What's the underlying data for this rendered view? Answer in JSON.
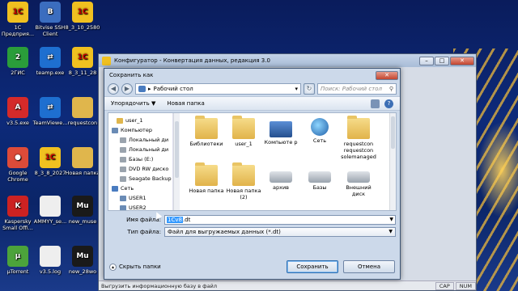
{
  "desktop": {
    "icons": [
      {
        "label": "1С Предприя...",
        "color": "#f0c020",
        "glyph": "1С"
      },
      {
        "label": "Bitvise SSH Client",
        "color": "#3b6dbf",
        "glyph": "B"
      },
      {
        "label": "8_3_10_2580",
        "color": "#f0c020",
        "glyph": "1С"
      },
      {
        "label": "2ГИС",
        "color": "#2a9d3a",
        "glyph": "2"
      },
      {
        "label": "teamp.exe",
        "color": "#1e6fd0",
        "glyph": "⇄"
      },
      {
        "label": "8_3_11_28",
        "color": "#f0c020",
        "glyph": "1С"
      },
      {
        "label": "v3.5.exe",
        "color": "#d42a2a",
        "glyph": "A"
      },
      {
        "label": "TeamViewe...",
        "color": "#1e6fd0",
        "glyph": "⇄"
      },
      {
        "label": "requestcon",
        "color": "#e0b64c",
        "glyph": ""
      },
      {
        "label": "Google Chrome",
        "color": "#dd4b39",
        "glyph": "●"
      },
      {
        "label": "8_3_8_2027",
        "color": "#f0c020",
        "glyph": "1С"
      },
      {
        "label": "Новая папка",
        "color": "#e0b64c",
        "glyph": ""
      },
      {
        "label": "Kaspersky Small Offi...",
        "color": "#c22",
        "glyph": "K"
      },
      {
        "label": "AMMYY_se...",
        "color": "#eee",
        "glyph": ""
      },
      {
        "label": "new_muse",
        "color": "#1a1a1a",
        "glyph": "Mu"
      },
      {
        "label": "µTorrent",
        "color": "#4ca33b",
        "glyph": "µ"
      },
      {
        "label": "v3.5.log",
        "color": "#eee",
        "glyph": ""
      },
      {
        "label": "new_28wo",
        "color": "#1a1a1a",
        "glyph": "Mu"
      }
    ]
  },
  "configurator": {
    "title": "Конфигуратор - Конвертация данных, редакция 3.0",
    "status_text": "Выгрузить информационную базу в файл",
    "status_caps": [
      "CAP",
      "NUM"
    ]
  },
  "dialog": {
    "title": "Сохранить как",
    "address": "Рабочий стол",
    "search_placeholder": "Поиск: Рабочий стол",
    "organize": "Упорядочить ▼",
    "new_folder": "Новая папка",
    "tree": [
      {
        "label": "user_1",
        "color": "#e0b64c",
        "indent": 10
      },
      {
        "label": "Компьютер",
        "color": "#6a8bb5",
        "indent": 4
      },
      {
        "label": "Локальный ди",
        "color": "#9aa3ad",
        "indent": 14
      },
      {
        "label": "Локальный ди",
        "color": "#9aa3ad",
        "indent": 14
      },
      {
        "label": "Базы (E:)",
        "color": "#9aa3ad",
        "indent": 14
      },
      {
        "label": "DVD RW диско",
        "color": "#9aa3ad",
        "indent": 14
      },
      {
        "label": "Seagate Backup",
        "color": "#9aa3ad",
        "indent": 14
      },
      {
        "label": "Сеть",
        "color": "#4a7cc0",
        "indent": 4
      },
      {
        "label": "USER1",
        "color": "#6a8bb5",
        "indent": 14
      },
      {
        "label": "USER2",
        "color": "#6a8bb5",
        "indent": 14
      }
    ],
    "files": [
      {
        "label": "Библиотеки",
        "kind": "folder"
      },
      {
        "label": "user_1",
        "kind": "folder"
      },
      {
        "label": "Компьюте р",
        "kind": "computer"
      },
      {
        "label": "Сеть",
        "kind": "network"
      },
      {
        "label": "requestcon requestcon solemanaged",
        "kind": "folder"
      },
      {
        "label": "Новая папка",
        "kind": "folder"
      },
      {
        "label": "Новая папка (2)",
        "kind": "folder"
      },
      {
        "label": "архив",
        "kind": "drive"
      },
      {
        "label": "Базы",
        "kind": "drive"
      },
      {
        "label": "Внешний диск",
        "kind": "drive"
      }
    ],
    "filename_label": "Имя файла:",
    "filename_selected": "1Cv8",
    "filename_rest": ".dt",
    "filetype_label": "Тип файла:",
    "filetype_value": "Файл для выгружаемых данных (*.dt)",
    "hide_folders": "Скрыть папки",
    "save": "Сохранить",
    "cancel": "Отмена"
  }
}
